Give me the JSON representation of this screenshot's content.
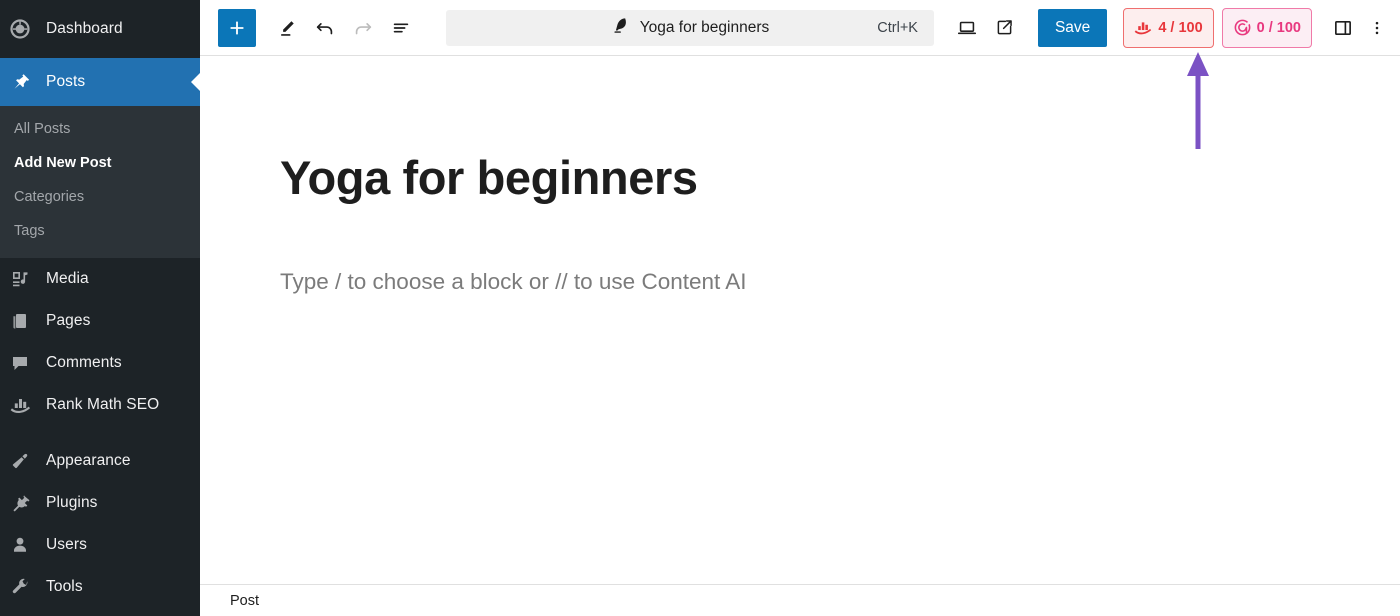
{
  "sidebar": {
    "items": [
      {
        "label": "Dashboard",
        "icon": "dashboard-icon",
        "state": "normal"
      },
      {
        "label": "Posts",
        "icon": "pin-icon",
        "state": "current"
      },
      {
        "label": "Media",
        "icon": "media-icon",
        "state": "normal"
      },
      {
        "label": "Pages",
        "icon": "pages-icon",
        "state": "normal"
      },
      {
        "label": "Comments",
        "icon": "comment-icon",
        "state": "normal"
      },
      {
        "label": "Rank Math SEO",
        "icon": "rank-math-icon",
        "state": "normal"
      },
      {
        "label": "Appearance",
        "icon": "appearance-icon",
        "state": "normal"
      },
      {
        "label": "Plugins",
        "icon": "plugin-icon",
        "state": "normal"
      },
      {
        "label": "Users",
        "icon": "users-icon",
        "state": "normal"
      },
      {
        "label": "Tools",
        "icon": "tools-icon",
        "state": "normal"
      }
    ],
    "submenu": [
      {
        "label": "All Posts",
        "active": false
      },
      {
        "label": "Add New Post",
        "active": true
      },
      {
        "label": "Categories",
        "active": false
      },
      {
        "label": "Tags",
        "active": false
      }
    ]
  },
  "toolbar": {
    "add_block_label": "+",
    "tools_icon": "pencil-icon",
    "undo_icon": "undo-icon",
    "redo_icon": "redo-icon",
    "list_view_icon": "list-view-icon",
    "command_bar": {
      "icon": "feather-icon",
      "title": "Yoga for beginners",
      "shortcut": "Ctrl+K"
    },
    "view_icon": "laptop-icon",
    "preview_icon": "external-link-icon",
    "save_label": "Save",
    "seo_score": {
      "icon": "rank-math-icon",
      "label": "4 / 100",
      "border_color": "#ef6f6f",
      "background_color": "#fdeeee",
      "text_color": "#e8373c"
    },
    "content_ai_score": {
      "icon": "content-ai-icon",
      "label": "0 / 100",
      "border_color": "#f07aa8",
      "background_color": "#fceef4",
      "text_color": "#e8387f"
    },
    "settings_sidebar_icon": "sidebar-toggle-icon",
    "options_icon": "more-vertical-icon"
  },
  "editor": {
    "title": "Yoga for beginners",
    "body_placeholder": "Type / to choose a block or // to use Content AI"
  },
  "footer": {
    "breadcrumb": "Post"
  },
  "annotation": {
    "arrow_color": "#7b52c4",
    "points_at": "seo-score-badge"
  },
  "colors": {
    "sidebar_bg": "#1d2327",
    "submenu_bg": "#2c3338",
    "accent_blue": "#0b76b8",
    "current_item_blue": "#2271b1"
  }
}
